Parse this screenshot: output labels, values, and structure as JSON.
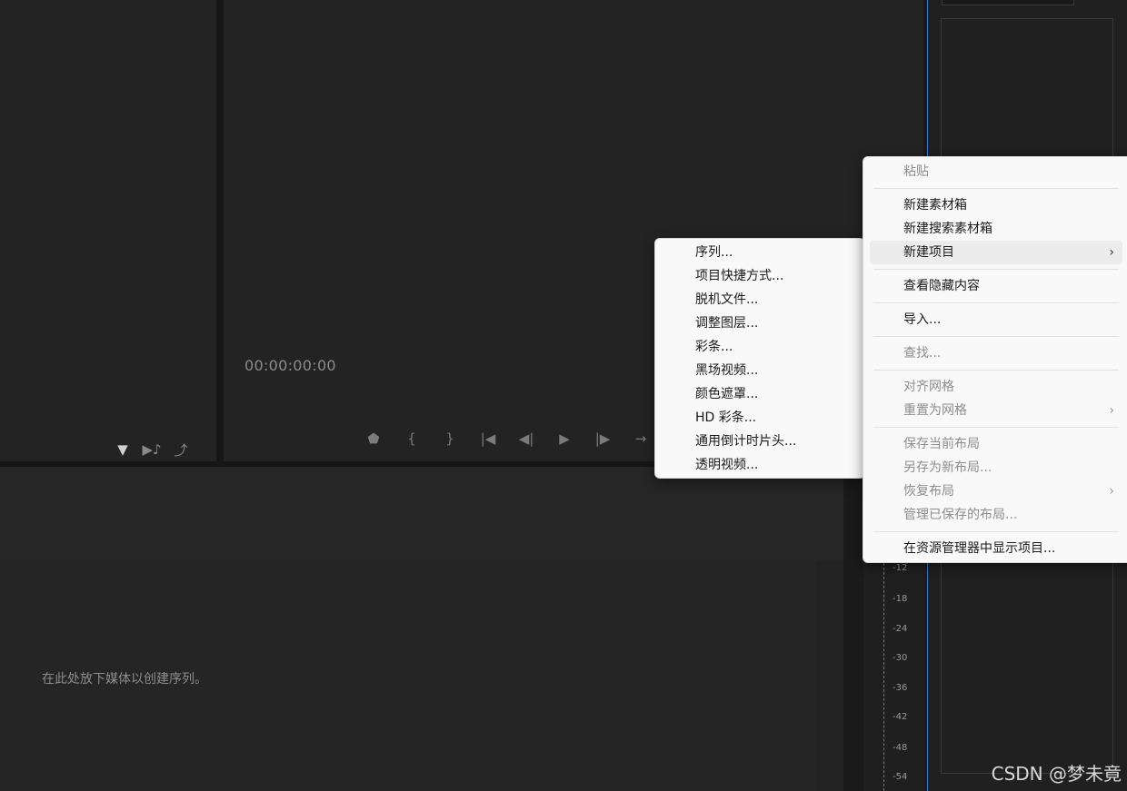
{
  "program_monitor": {
    "timecode": "00:00:00:00",
    "transport_icons": [
      "marker-icon",
      "mark-in-icon",
      "mark-out-icon",
      "go-to-in-icon",
      "step-back-icon",
      "play-icon",
      "step-forward-icon",
      "go-to-out-icon"
    ]
  },
  "project_panel": {
    "icons": [
      "filter-icon",
      "automate-to-sequence-icon",
      "export-icon"
    ]
  },
  "timeline": {
    "hint": "在此处放下媒体以创建序列。"
  },
  "audio_meter": {
    "labels": [
      "-12",
      "-18",
      "-24",
      "-30",
      "-36",
      "-42",
      "-48",
      "-54"
    ]
  },
  "main_menu": {
    "items": [
      {
        "label": "粘贴",
        "enabled": false
      },
      {
        "label": "新建素材箱",
        "enabled": true
      },
      {
        "label": "新建搜索素材箱",
        "enabled": true
      },
      {
        "label": "新建项目",
        "enabled": true,
        "submenu": true,
        "highlighted": true
      },
      {
        "label": "查看隐藏内容",
        "enabled": true
      },
      {
        "label": "导入...",
        "enabled": true
      },
      {
        "label": "查找...",
        "enabled": false
      },
      {
        "label": "对齐网格",
        "enabled": false
      },
      {
        "label": "重置为网格",
        "enabled": false,
        "submenu": true
      },
      {
        "label": "保存当前布局",
        "enabled": false
      },
      {
        "label": "另存为新布局...",
        "enabled": false
      },
      {
        "label": "恢复布局",
        "enabled": false,
        "submenu": true
      },
      {
        "label": "管理已保存的布局...",
        "enabled": false
      },
      {
        "label": "在资源管理器中显示项目...",
        "enabled": true
      }
    ]
  },
  "sub_menu": {
    "items": [
      {
        "label": "序列..."
      },
      {
        "label": "项目快捷方式..."
      },
      {
        "label": "脱机文件..."
      },
      {
        "label": "调整图层..."
      },
      {
        "label": "彩条..."
      },
      {
        "label": "黑场视频..."
      },
      {
        "label": "颜色遮罩..."
      },
      {
        "label": "HD 彩条..."
      },
      {
        "label": "通用倒计时片头..."
      },
      {
        "label": "透明视频..."
      }
    ]
  },
  "watermark": "CSDN @梦未竟",
  "colors": {
    "accent": "#3b79c8",
    "panel_bg": "#232323",
    "menu_bg": "#f9f9f9",
    "menu_disabled_text": "#8d8d8d"
  }
}
